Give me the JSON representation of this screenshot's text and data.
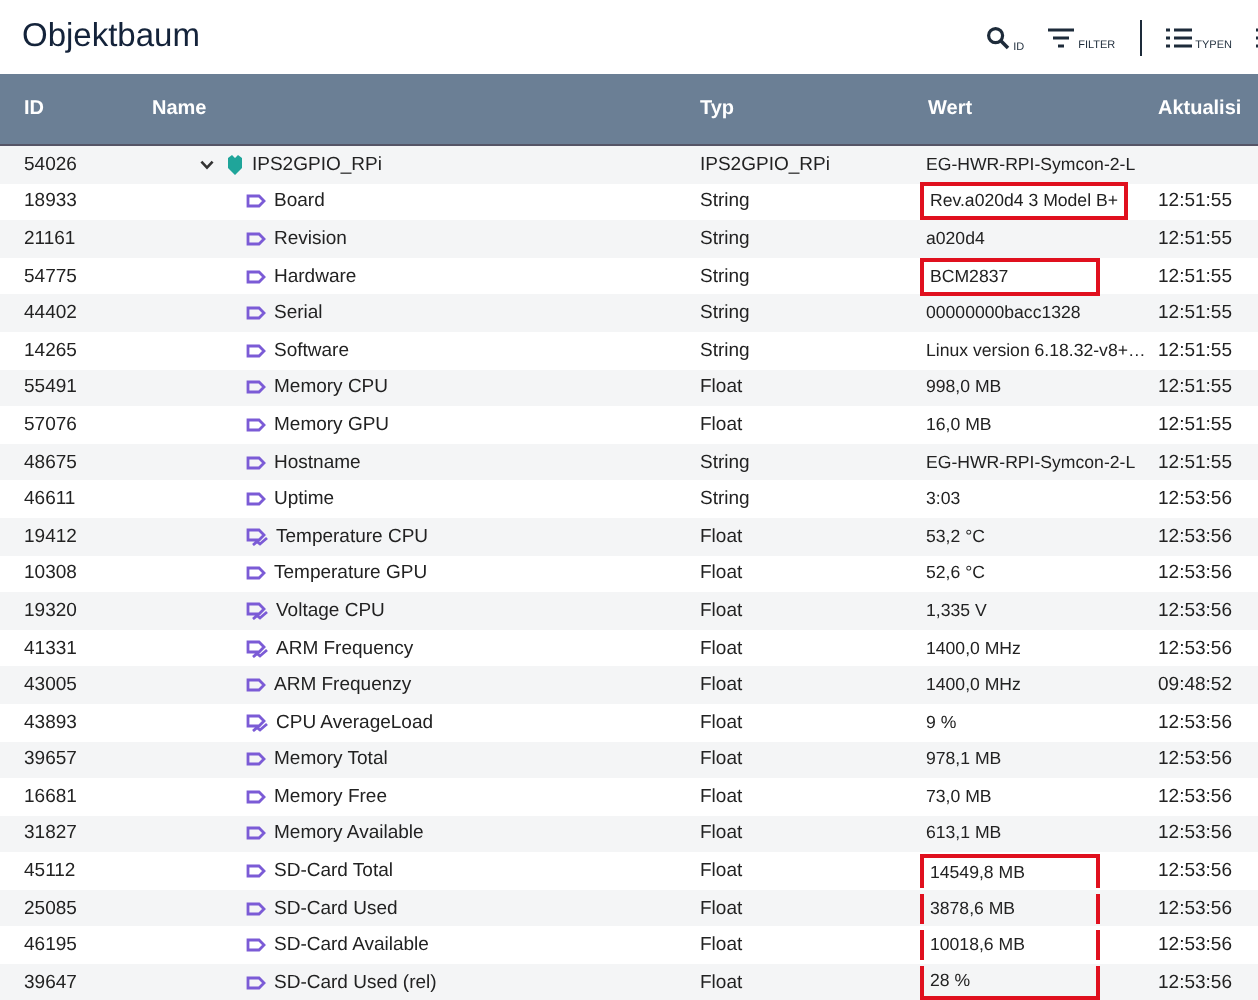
{
  "title": "Objektbaum",
  "toolbar": [
    {
      "kind": "search",
      "label": "ID"
    },
    {
      "kind": "filter",
      "label": "FILTER"
    },
    {
      "kind": "divider"
    },
    {
      "kind": "list",
      "label": "TYPEN"
    },
    {
      "kind": "list"
    }
  ],
  "table": {
    "columns": [
      "ID",
      "Name",
      "Typ",
      "Wert",
      "Aktualisi"
    ],
    "rows": [
      {
        "id": "54026",
        "name": "IPS2GPIO_RPi",
        "type": "IPS2GPIO_RPi",
        "value": "EG-HWR-RPI-Symcon-2-L",
        "kind": "instance",
        "expanded": true,
        "children": [
          {
            "id": "18933",
            "name": "Board",
            "type": "String",
            "value": "Rev.a020d4 3 Model B+",
            "updated": "12:51:55",
            "kind": "variable",
            "highlighted": true
          },
          {
            "id": "21161",
            "name": "Revision",
            "type": "String",
            "value": "a020d4",
            "updated": "12:51:55",
            "kind": "variable",
            "highlighted": false
          },
          {
            "id": "54775",
            "name": "Hardware",
            "type": "String",
            "value": "BCM2837",
            "updated": "12:51:55",
            "kind": "variable",
            "highlighted": true
          },
          {
            "id": "44402",
            "name": "Serial",
            "type": "String",
            "value": "00000000bacc1328",
            "updated": "12:51:55",
            "kind": "variable",
            "highlighted": false
          },
          {
            "id": "14265",
            "name": "Software",
            "type": "String",
            "value": "Linux version 6.18.32-v8+…",
            "updated": "12:51:55",
            "kind": "variable",
            "highlighted": false
          },
          {
            "id": "55491",
            "name": "Memory CPU",
            "type": "Float",
            "value": "998,0 MB",
            "updated": "12:51:55",
            "kind": "variable",
            "highlighted": false
          },
          {
            "id": "57076",
            "name": "Memory GPU",
            "type": "Float",
            "value": "16,0 MB",
            "updated": "12:51:55",
            "kind": "variable",
            "highlighted": false
          },
          {
            "id": "48675",
            "name": "Hostname",
            "type": "String",
            "value": "EG-HWR-RPI-Symcon-2-L",
            "updated": "12:51:55",
            "kind": "variable",
            "highlighted": false
          },
          {
            "id": "46611",
            "name": "Uptime",
            "type": "String",
            "value": "3:03",
            "updated": "12:53:56",
            "kind": "variable",
            "highlighted": false
          },
          {
            "id": "19412",
            "name": "Temperature CPU",
            "type": "Float",
            "value": "53,2 °C",
            "updated": "12:53:56",
            "kind": "logged",
            "highlighted": false
          },
          {
            "id": "10308",
            "name": "Temperature GPU",
            "type": "Float",
            "value": "52,6 °C",
            "updated": "12:53:56",
            "kind": "variable",
            "highlighted": false
          },
          {
            "id": "19320",
            "name": "Voltage CPU",
            "type": "Float",
            "value": "1,335 V",
            "updated": "12:53:56",
            "kind": "logged",
            "highlighted": false
          },
          {
            "id": "41331",
            "name": "ARM Frequency",
            "type": "Float",
            "value": "1400,0 MHz",
            "updated": "12:53:56",
            "kind": "logged",
            "highlighted": false
          },
          {
            "id": "43005",
            "name": "ARM Frequenzy",
            "type": "Float",
            "value": "1400,0 MHz",
            "updated": "09:48:52",
            "kind": "variable",
            "highlighted": false
          },
          {
            "id": "43893",
            "name": "CPU AverageLoad",
            "type": "Float",
            "value": "9 %",
            "updated": "12:53:56",
            "kind": "logged",
            "highlighted": false
          },
          {
            "id": "39657",
            "name": "Memory Total",
            "type": "Float",
            "value": "978,1 MB",
            "updated": "12:53:56",
            "kind": "variable",
            "highlighted": false
          },
          {
            "id": "16681",
            "name": "Memory Free",
            "type": "Float",
            "value": "73,0 MB",
            "updated": "12:53:56",
            "kind": "variable",
            "highlighted": false
          },
          {
            "id": "31827",
            "name": "Memory Available",
            "type": "Float",
            "value": "613,1 MB",
            "updated": "12:53:56",
            "kind": "variable",
            "highlighted": false
          },
          {
            "id": "45112",
            "name": "SD-Card Total",
            "type": "Float",
            "value": "14549,8 MB",
            "updated": "12:53:56",
            "kind": "variable",
            "highlighted": true
          },
          {
            "id": "25085",
            "name": "SD-Card Used",
            "type": "Float",
            "value": "3878,6 MB",
            "updated": "12:53:56",
            "kind": "variable",
            "highlighted": true
          },
          {
            "id": "46195",
            "name": "SD-Card Available",
            "type": "Float",
            "value": "10018,6 MB",
            "updated": "12:53:56",
            "kind": "variable",
            "highlighted": true
          },
          {
            "id": "39647",
            "name": "SD-Card Used (rel)",
            "type": "Float",
            "value": "28 %",
            "updated": "12:53:56",
            "kind": "variable",
            "highlighted": true
          }
        ]
      }
    ]
  }
}
